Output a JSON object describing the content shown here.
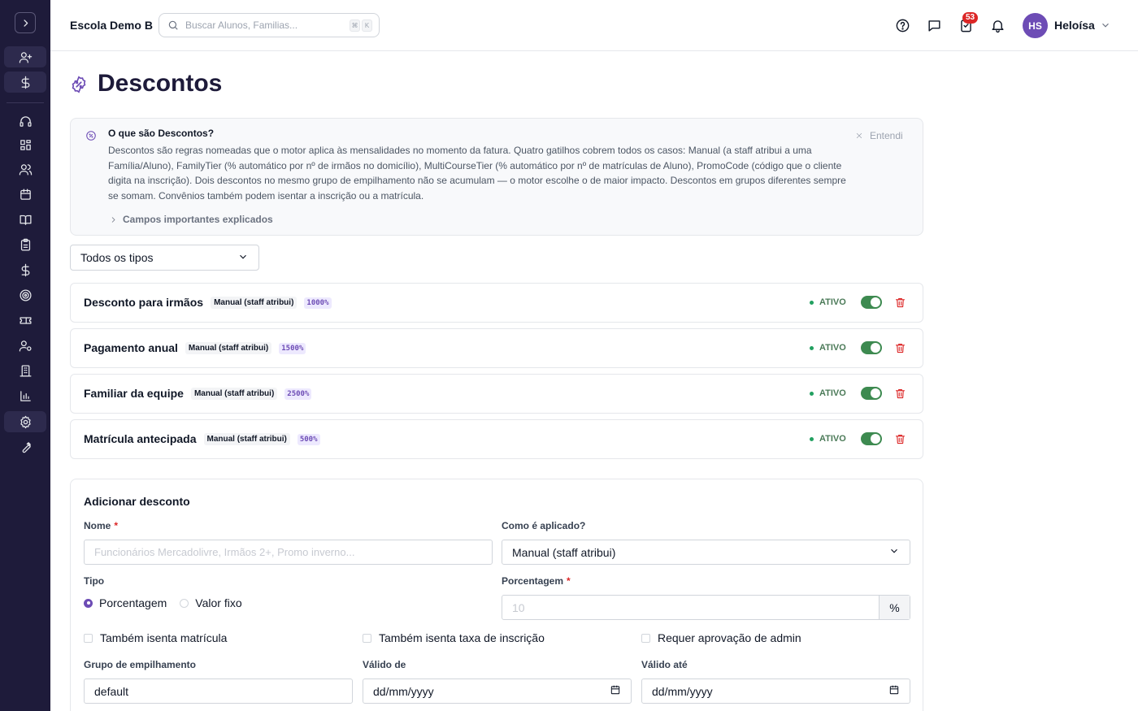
{
  "header": {
    "school_name": "Escola Demo B",
    "search_placeholder": "Buscar Alunos, Familias...",
    "shortcut_keys": [
      "⌘",
      "K"
    ],
    "notification_count": "53",
    "user_initials": "HS",
    "user_name": "Heloísa"
  },
  "sidebar": {
    "icons": [
      "user-plus-icon",
      "dollar-icon",
      "headset-icon",
      "grid-icon",
      "users-icon",
      "calendar-icon",
      "book-icon",
      "clipboard-icon",
      "dollar-icon",
      "target-icon",
      "ticket-icon",
      "user-gear-icon",
      "building-icon",
      "bar-chart-icon",
      "gear-icon",
      "wrench-icon"
    ],
    "active_icon": "gear-icon"
  },
  "page": {
    "title": "Descontos"
  },
  "info": {
    "title": "O que são Descontos?",
    "text": "Descontos são regras nomeadas que o motor aplica às mensalidades no momento da fatura. Quatro gatilhos cobrem todos os casos: Manual (a staff atribui a uma Família/Aluno), FamilyTier (% automático por nº de irmãos no domicílio), MultiCourseTier (% automático por nº de matrículas de Aluno), PromoCode (código que o cliente digita na inscrição). Dois descontos no mesmo grupo de empilhamento não se acumulam — o motor escolhe o de maior impacto. Descontos em grupos diferentes sempre se somam. Convênios também podem isentar a inscrição ou a matrícula.",
    "dismiss_label": "Entendi",
    "expand_label": "Campos importantes explicados"
  },
  "filter": {
    "selected": "Todos os tipos"
  },
  "discounts": [
    {
      "name": "Desconto para irmãos",
      "kind": "Manual (staff atribui)",
      "value": "1000%",
      "status": "ATIVO",
      "enabled": true
    },
    {
      "name": "Pagamento anual",
      "kind": "Manual (staff atribui)",
      "value": "1500%",
      "status": "ATIVO",
      "enabled": true
    },
    {
      "name": "Familiar da equipe",
      "kind": "Manual (staff atribui)",
      "value": "2500%",
      "status": "ATIVO",
      "enabled": true
    },
    {
      "name": "Matrícula antecipada",
      "kind": "Manual (staff atribui)",
      "value": "500%",
      "status": "ATIVO",
      "enabled": true
    }
  ],
  "form": {
    "title": "Adicionar desconto",
    "name_label": "Nome",
    "name_placeholder": "Funcionários Mercadolivre, Irmãos 2+, Promo inverno...",
    "applied_label": "Como é aplicado?",
    "applied_value": "Manual (staff atribui)",
    "type_label": "Tipo",
    "type_options": [
      "Porcentagem",
      "Valor fixo"
    ],
    "type_selected": "Porcentagem",
    "percent_label": "Porcentagem",
    "percent_placeholder": "10",
    "percent_suffix": "%",
    "checkboxes": [
      "Também isenta matrícula",
      "Também isenta taxa de inscrição",
      "Requer aprovação de admin"
    ],
    "stack_label": "Grupo de empilhamento",
    "stack_value": "default",
    "valid_from_label": "Válido de",
    "valid_from_value": "dd/mm/yyyy",
    "valid_to_label": "Válido até",
    "valid_to_value": "dd/mm/yyyy"
  },
  "colors": {
    "sidebar_bg": "#1e1b3a",
    "accent": "#6d4cb5",
    "active_green": "#3d8a50",
    "danger": "#dc2626"
  }
}
